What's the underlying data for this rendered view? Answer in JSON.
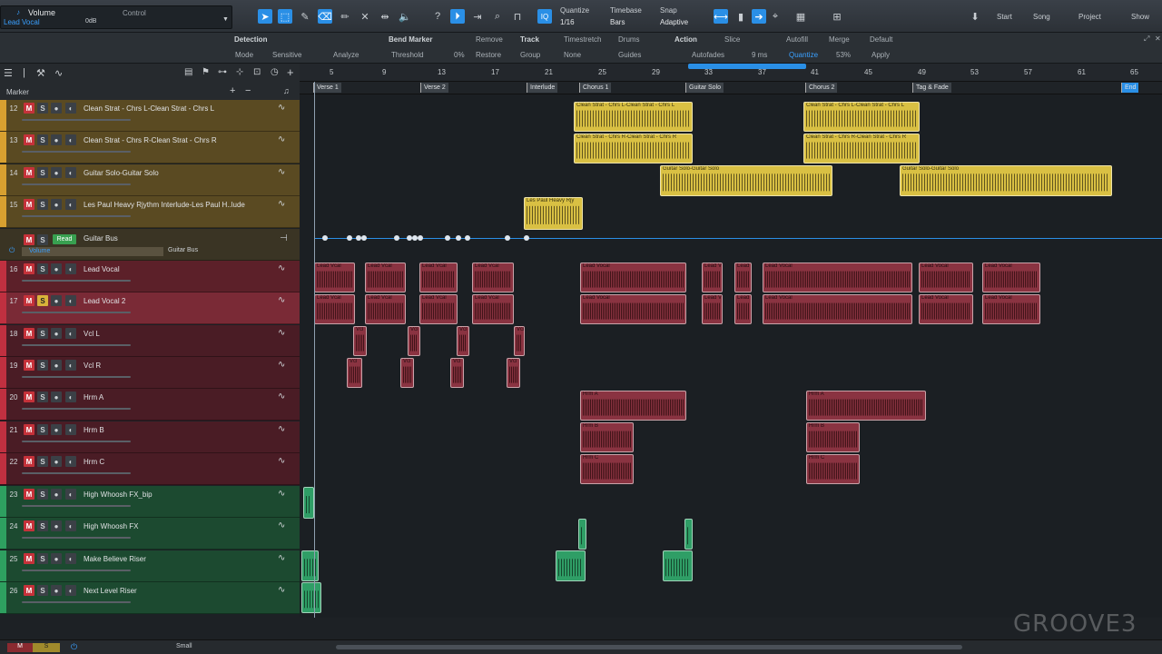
{
  "inspector": {
    "param": "Volume",
    "track": "Lead Vocal",
    "value": "0dB",
    "control": "Control"
  },
  "toolbar": {
    "quantize_label": "Quantize",
    "quantize_value": "1/16",
    "timebase_label": "Timebase",
    "timebase_value": "Bars",
    "snap_label": "Snap",
    "snap_value": "Adaptive",
    "start": "Start",
    "song": "Song",
    "project": "Project",
    "show": "Show"
  },
  "editbar": {
    "detection": "Detection",
    "mode": "Mode",
    "sensitive": "Sensitive",
    "analyze": "Analyze",
    "bend_marker": "Bend Marker",
    "remove": "Remove",
    "threshold": "Threshold",
    "threshold_val": "0%",
    "restore": "Restore",
    "track": "Track",
    "timestretch": "Timestretch",
    "drums": "Drums",
    "group": "Group",
    "none": "None",
    "guides": "Guides",
    "action": "Action",
    "slice": "Slice",
    "autofill": "Autofill",
    "merge": "Merge",
    "default": "Default",
    "autofades": "Autofades",
    "ms": "9 ms",
    "quantize": "Quantize",
    "pct": "53%",
    "apply": "Apply"
  },
  "track_list_header": {
    "marker": "Marker"
  },
  "ruler": {
    "ticks": [
      "5",
      "9",
      "13",
      "17",
      "21",
      "25",
      "29",
      "33",
      "37",
      "41",
      "45",
      "49",
      "53",
      "57",
      "61",
      "65"
    ]
  },
  "markers": [
    "Verse 1",
    "Verse 2",
    "Interlude",
    "Chorus 1",
    "Guitar Solo",
    "Chorus 2",
    "Tag & Fade",
    "End"
  ],
  "tracks": [
    {
      "num": "12",
      "name": "Clean Strat - Chrs L-Clean Strat - Chrs L",
      "color": "#5a4a22",
      "solo": false
    },
    {
      "num": "13",
      "name": "Clean Strat - Chrs R-Clean Strat - Chrs R",
      "color": "#5a4a22",
      "solo": false
    },
    {
      "num": "14",
      "name": "Guitar Solo-Guitar Solo",
      "color": "#5a4a22",
      "solo": false
    },
    {
      "num": "15",
      "name": "Les Paul Heavy Rjythm Interlude-Les Paul H..lude",
      "color": "#5a4a22",
      "solo": false
    },
    {
      "num": "16",
      "name": "Lead Vocal",
      "color": "#5c2029",
      "solo": false
    },
    {
      "num": "17",
      "name": "Lead Vocal 2",
      "color": "#7a2a36",
      "solo": true
    },
    {
      "num": "18",
      "name": "Vcl L",
      "color": "#4a1c25",
      "solo": false
    },
    {
      "num": "19",
      "name": "Vcl R",
      "color": "#4a1c25",
      "solo": false
    },
    {
      "num": "20",
      "name": "Hrm A",
      "color": "#4a1c25",
      "solo": false
    },
    {
      "num": "21",
      "name": "Hrm B",
      "color": "#4a1c25",
      "solo": false
    },
    {
      "num": "22",
      "name": "Hrm C",
      "color": "#4a1c25",
      "solo": false
    },
    {
      "num": "23",
      "name": "High Whoosh FX_bip",
      "color": "#1c4a30",
      "solo": false
    },
    {
      "num": "24",
      "name": "High Whoosh FX",
      "color": "#1c4a30",
      "solo": false
    },
    {
      "num": "25",
      "name": "Make Believe Riser",
      "color": "#1c4a30",
      "solo": false
    },
    {
      "num": "26",
      "name": "Next Level Riser",
      "color": "#1c4a30",
      "solo": false
    }
  ],
  "bus": {
    "read": "Read",
    "name": "Guitar Bus",
    "param": "Volume",
    "param_target": "Guitar Bus"
  },
  "clips": {
    "chrs_l": "Clean Strat - Chrs L-Clean Strat - Chrs L",
    "chrs_r": "Clean Strat - Chrs R-Clean Strat - Chrs R",
    "solo": "Guitar Solo-Guitar Solo",
    "lp": "Les Paul Heavy Rjy",
    "lv": "Lead Vocal",
    "lv_short": "Lead Vcal",
    "vcl": "Vcl",
    "hrm_a": "Hrm A",
    "hrm_b": "Hrm B",
    "hrm_c": "Hrm C"
  },
  "bottom": {
    "size": "Small"
  },
  "watermark": "GROOVE3"
}
